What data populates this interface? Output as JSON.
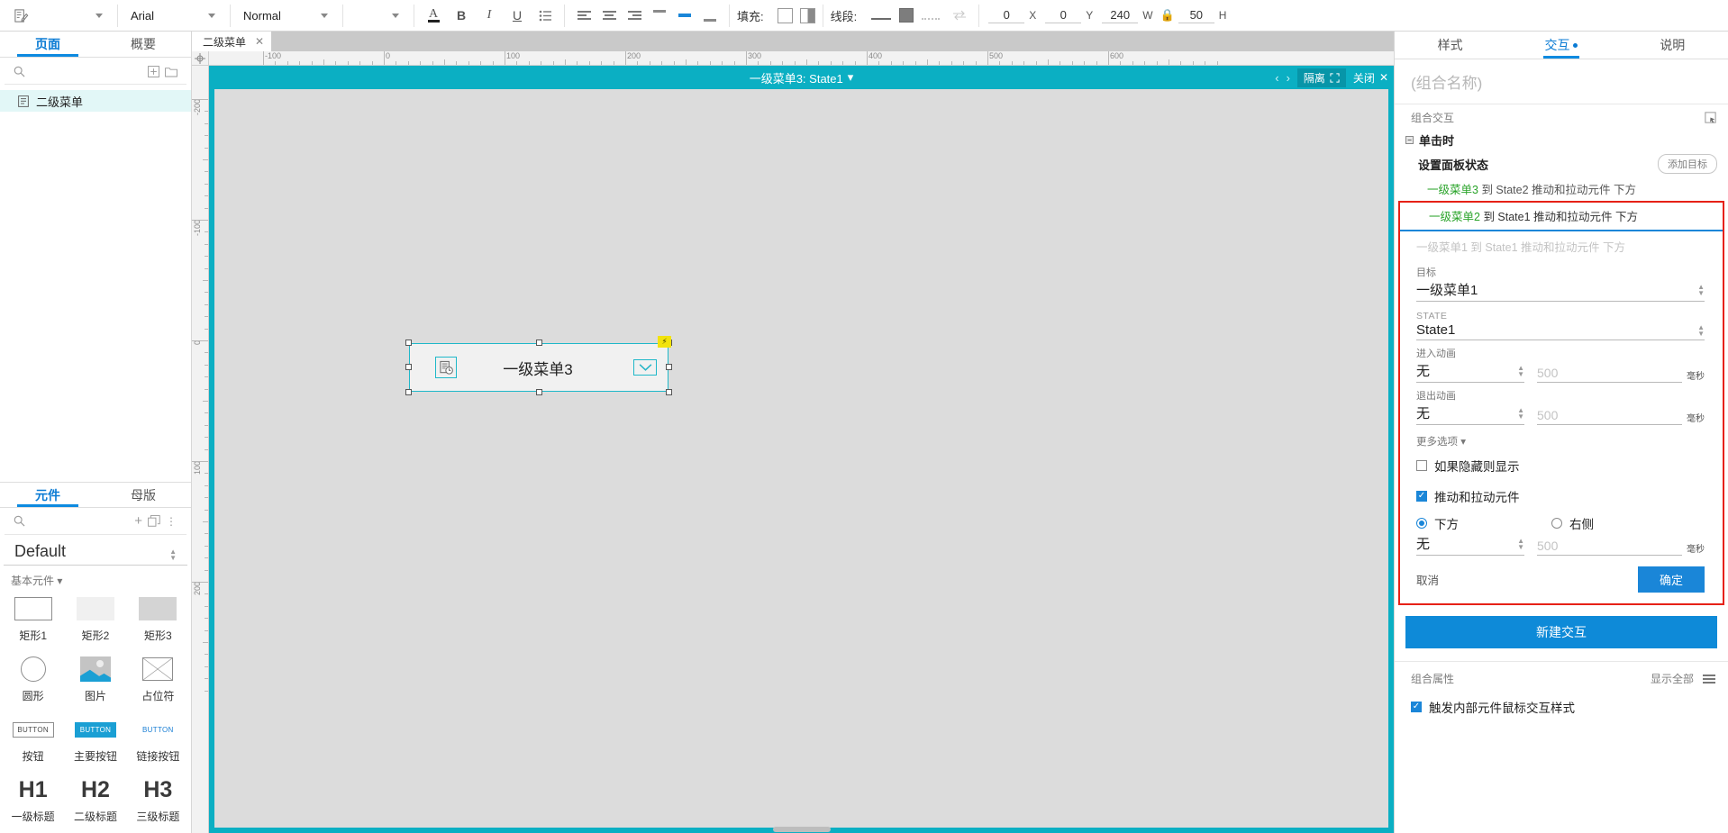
{
  "toolbar": {
    "style_icon": "style-edit-icon",
    "font_family": "Arial",
    "font_weight": "Normal",
    "font_size": "",
    "fill_label": "填充:",
    "line_label": "线段:",
    "x_value": "0",
    "x_label": "X",
    "y_value": "0",
    "y_label": "Y",
    "w_value": "240",
    "w_label": "W",
    "h_value": "50",
    "h_label": "H"
  },
  "left_panel": {
    "tabs": [
      {
        "label": "页面",
        "active": true
      },
      {
        "label": "概要",
        "active": false
      }
    ],
    "search_placeholder": "",
    "pages": [
      {
        "label": "二级菜单",
        "selected": true
      }
    ]
  },
  "library_panel": {
    "tabs": [
      {
        "label": "元件",
        "active": true
      },
      {
        "label": "母版",
        "active": false
      }
    ],
    "library_name": "Default",
    "group_label": "基本元件",
    "widgets": [
      {
        "label": "矩形1",
        "icon": "rectangle-outline-icon"
      },
      {
        "label": "矩形2",
        "icon": "rectangle-light-icon"
      },
      {
        "label": "矩形3",
        "icon": "rectangle-dark-icon"
      },
      {
        "label": "圆形",
        "icon": "circle-icon"
      },
      {
        "label": "图片",
        "icon": "image-icon"
      },
      {
        "label": "占位符",
        "icon": "placeholder-icon"
      },
      {
        "label": "按钮",
        "icon": "button-outline-icon",
        "glyph": "BUTTON"
      },
      {
        "label": "主要按钮",
        "icon": "button-primary-icon",
        "glyph": "BUTTON"
      },
      {
        "label": "链接按钮",
        "icon": "button-link-icon",
        "glyph": "BUTTON"
      },
      {
        "label": "一级标题",
        "icon": "heading-1-icon",
        "glyph": "H1"
      },
      {
        "label": "二级标题",
        "icon": "heading-2-icon",
        "glyph": "H2"
      },
      {
        "label": "三级标题",
        "icon": "heading-3-icon",
        "glyph": "H3"
      }
    ]
  },
  "canvas": {
    "file_tab": "二级菜单",
    "state_bar": {
      "title": "一级菜单3: State1",
      "isolate_label": "隔离",
      "close_label": "关闭"
    },
    "ruler_h_labels": [
      "-100",
      "0",
      "100",
      "200",
      "300",
      "400",
      "500",
      "600"
    ],
    "ruler_v_labels": [
      "-200",
      "-100",
      "0",
      "100",
      "200"
    ],
    "widget": {
      "text": "一级菜单3",
      "left_icon": "document-clock-icon",
      "right_icon": "chevron-down-icon",
      "interaction_marker": "lightning-icon"
    }
  },
  "right_panel": {
    "tabs": [
      {
        "label": "样式",
        "active": false,
        "dot": false
      },
      {
        "label": "交互",
        "active": true,
        "dot": true
      },
      {
        "label": "说明",
        "active": false,
        "dot": false
      }
    ],
    "group_name_placeholder": "(组合名称)",
    "section_label": "组合交互",
    "select_icon": "select-target-icon",
    "event": {
      "label": "单击时",
      "action_label": "设置面板状态",
      "add_target_label": "添加目标",
      "targets": [
        {
          "name": "一级菜单3",
          "rest": "到 State2 推动和拉动元件 下方",
          "active": false
        },
        {
          "name": "一级菜单2",
          "rest": "到 State1 推动和拉动元件 下方",
          "active": true
        }
      ]
    },
    "dialog": {
      "summary_line": "一级菜单1 到 State1 推动和拉动元件 下方",
      "target_label": "目标",
      "target_value": "一级菜单1",
      "state_label": "STATE",
      "state_value": "State1",
      "enter_anim_label": "进入动画",
      "enter_anim_value": "无",
      "enter_anim_ms_placeholder": "500",
      "enter_anim_unit": "毫秒",
      "exit_anim_label": "退出动画",
      "exit_anim_value": "无",
      "exit_anim_ms_placeholder": "500",
      "exit_anim_unit": "毫秒",
      "more_options_label": "更多选项",
      "show_if_hidden_label": "如果隐藏则显示",
      "show_if_hidden_checked": false,
      "push_pull_label": "推动和拉动元件",
      "push_pull_checked": true,
      "direction_below_label": "下方",
      "direction_right_label": "右侧",
      "direction_selected": "below",
      "push_anim_value": "无",
      "push_anim_ms_placeholder": "500",
      "push_anim_unit": "毫秒",
      "cancel_label": "取消",
      "ok_label": "确定"
    },
    "new_interaction_label": "新建交互",
    "group_properties": {
      "label": "组合属性",
      "show_all_label": "显示全部",
      "menu_icon": "hamburger-icon",
      "checkbox_label": "触发内部元件鼠标交互样式",
      "checkbox_checked": true
    }
  },
  "colors": {
    "accent_blue": "#0e8ad8",
    "teal": "#0bafc3",
    "red_highlight": "#e62117",
    "green_target": "#29a329"
  }
}
